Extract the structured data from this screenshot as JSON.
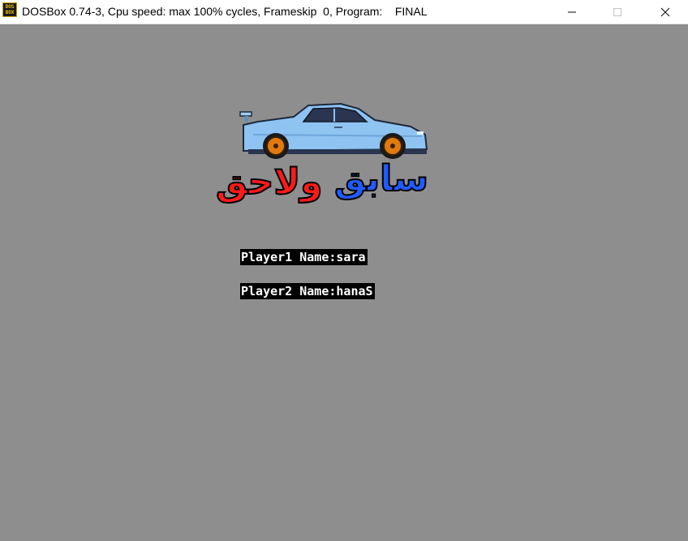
{
  "window": {
    "icon_label_top": "DOS",
    "icon_label_bottom": "BOX",
    "title": "DOSBox 0.74-3, Cpu speed: max 100% cycles, Frameskip  0, Program:    FINAL",
    "controls": {
      "minimize_icon": "minimize-icon",
      "maximize_icon": "maximize-icon",
      "close_icon": "close-icon"
    }
  },
  "game": {
    "background_color": "#8e8e8e",
    "logo": {
      "car_color": "#8fc3f2",
      "wheel_color": "#e07a10",
      "word_right": "سابق",
      "word_right_color": "#1f5bff",
      "word_left": "ولاحق",
      "word_left_color": "#ff1a1a"
    },
    "players": [
      {
        "label": "Player1 Name:",
        "name": "sara"
      },
      {
        "label": "Player2 Name:",
        "name": "hanaS"
      }
    ]
  }
}
